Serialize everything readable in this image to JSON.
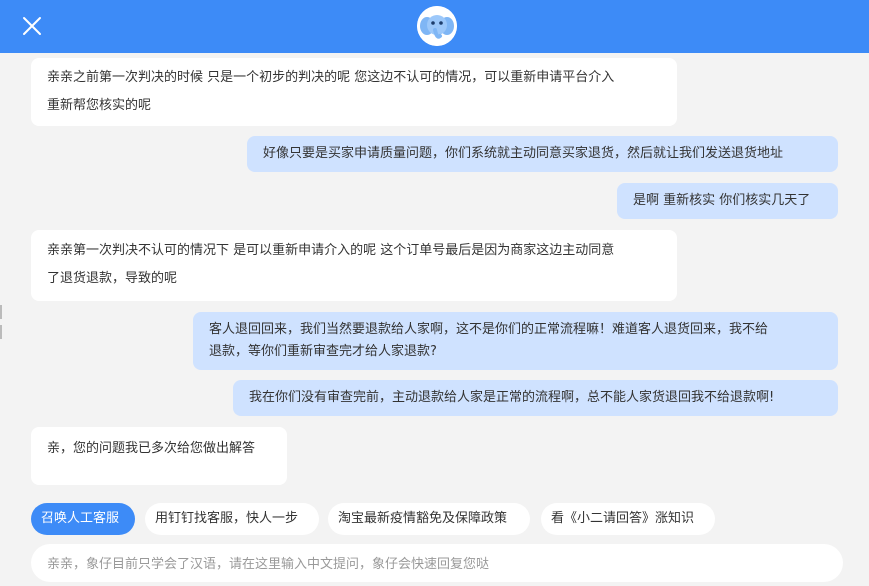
{
  "header": {
    "close_icon": "close-icon",
    "avatar_icon": "elephant-avatar-icon",
    "accent": "#3d8bf7"
  },
  "messages": [
    {
      "side": "in",
      "lines": [
        "亲亲之前第一次判决的时候 只是一个初步的判决的呢 您这边不认可的情况，可以重新申请平台介入",
        "重新帮您核实的呢"
      ]
    },
    {
      "side": "out",
      "lines": [
        "好像只要是买家申请质量问题，你们系统就主动同意买家退货，然后就让我们发送退货地址"
      ]
    },
    {
      "side": "out",
      "lines": [
        "是啊 重新核实 你们核实几天了"
      ]
    },
    {
      "side": "in",
      "lines": [
        "亲亲第一次判决不认可的情况下 是可以重新申请介入的呢 这个订单号最后是因为商家这边主动同意",
        "了退货退款，导致的呢"
      ]
    },
    {
      "side": "out",
      "lines": [
        "客人退回回来，我们当然要退款给人家啊，这不是你们的正常流程嘛！难道客人退货回来，我不给",
        "退款，等你们重新审查完才给人家退款?"
      ]
    },
    {
      "side": "out",
      "lines": [
        "我在你们没有审查完前，主动退款给人家是正常的流程啊，总不能人家货退回我不给退款啊!"
      ]
    },
    {
      "side": "in",
      "lines": [
        "亲，您的问题我已多次给您做出解答"
      ]
    }
  ],
  "quick_replies": [
    {
      "label": "召唤人工客服",
      "primary": true
    },
    {
      "label": "用钉钉找客服，快人一步",
      "primary": false
    },
    {
      "label": "淘宝最新疫情豁免及保障政策",
      "primary": false
    },
    {
      "label": "看《小二请回答》涨知识",
      "primary": false
    }
  ],
  "input": {
    "placeholder": "亲亲，象仔目前只学会了汉语，请在这里输入中文提问，象仔会快速回复您哒",
    "value": ""
  }
}
